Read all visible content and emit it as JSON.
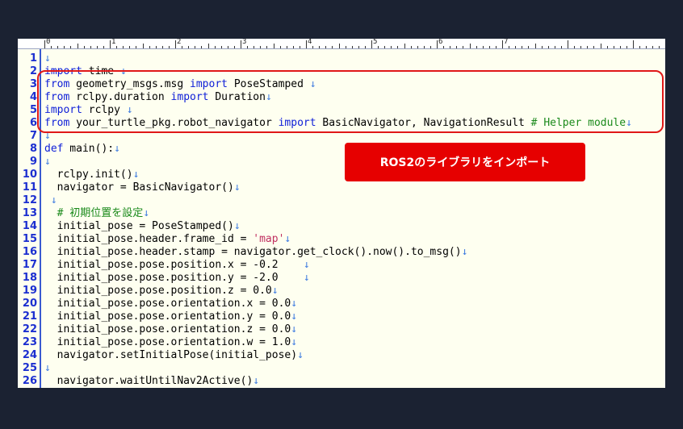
{
  "annotation": {
    "callout_text": "ROS2のライブラリをインポート",
    "callout_color": "#e60000",
    "highlight_border_color": "#e01818"
  },
  "editor": {
    "ruler_numbers": [
      "0",
      "1",
      "2",
      "3",
      "4",
      "5",
      "6",
      "7"
    ],
    "line_numbers": [
      "1",
      "2",
      "3",
      "4",
      "5",
      "6",
      "7",
      "8",
      "9",
      "10",
      "11",
      "12",
      "13",
      "14",
      "15",
      "16",
      "17",
      "18",
      "19",
      "20",
      "21",
      "22",
      "23",
      "24",
      "25",
      "26"
    ],
    "eol_mark": "↓",
    "lines": [
      [],
      [
        [
          "kw",
          "import"
        ],
        [
          "t",
          " time "
        ],
        [
          "eol",
          "↓"
        ]
      ],
      [
        [
          "kw",
          "from"
        ],
        [
          "t",
          " geometry_msgs.msg "
        ],
        [
          "kw",
          "import"
        ],
        [
          "t",
          " PoseStamped "
        ],
        [
          "eol",
          "↓"
        ]
      ],
      [
        [
          "kw",
          "from"
        ],
        [
          "t",
          " rclpy.duration "
        ],
        [
          "kw",
          "import"
        ],
        [
          "t",
          " Duration"
        ],
        [
          "eol",
          "↓"
        ]
      ],
      [
        [
          "kw",
          "import"
        ],
        [
          "t",
          " rclpy "
        ],
        [
          "eol",
          "↓"
        ]
      ],
      [
        [
          "kw",
          "from"
        ],
        [
          "t",
          " your_turtle_pkg.robot_navigator "
        ],
        [
          "kw",
          "import"
        ],
        [
          "t",
          " BasicNavigator, NavigationResult "
        ],
        [
          "cmt",
          "# Helper module"
        ],
        [
          "eol",
          "↓"
        ]
      ],
      [],
      [
        [
          "kw",
          "def"
        ],
        [
          "t",
          " main():"
        ],
        [
          "eol",
          "↓"
        ]
      ],
      [],
      [
        [
          "t",
          "  rclpy.init()"
        ],
        [
          "eol",
          "↓"
        ]
      ],
      [
        [
          "t",
          "  navigator = BasicNavigator()"
        ],
        [
          "eol",
          "↓"
        ]
      ],
      [
        [
          "t",
          " "
        ],
        [
          "eol",
          "↓"
        ]
      ],
      [
        [
          "t",
          "  "
        ],
        [
          "cmt",
          "# 初期位置を設定"
        ],
        [
          "eol",
          "↓"
        ]
      ],
      [
        [
          "t",
          "  initial_pose = PoseStamped()"
        ],
        [
          "eol",
          "↓"
        ]
      ],
      [
        [
          "t",
          "  initial_pose.header.frame_id = "
        ],
        [
          "str",
          "'map'"
        ],
        [
          "eol",
          "↓"
        ]
      ],
      [
        [
          "t",
          "  initial_pose.header.stamp = navigator.get_clock().now().to_msg()"
        ],
        [
          "eol",
          "↓"
        ]
      ],
      [
        [
          "t",
          "  initial_pose.pose.position.x = -0.2    "
        ],
        [
          "eol",
          "↓"
        ]
      ],
      [
        [
          "t",
          "  initial_pose.pose.position.y = -2.0    "
        ],
        [
          "eol",
          "↓"
        ]
      ],
      [
        [
          "t",
          "  initial_pose.pose.position.z = 0.0"
        ],
        [
          "eol",
          "↓"
        ]
      ],
      [
        [
          "t",
          "  initial_pose.pose.orientation.x = 0.0"
        ],
        [
          "eol",
          "↓"
        ]
      ],
      [
        [
          "t",
          "  initial_pose.pose.orientation.y = 0.0"
        ],
        [
          "eol",
          "↓"
        ]
      ],
      [
        [
          "t",
          "  initial_pose.pose.orientation.z = 0.0"
        ],
        [
          "eol",
          "↓"
        ]
      ],
      [
        [
          "t",
          "  initial_pose.pose.orientation.w = 1.0"
        ],
        [
          "eol",
          "↓"
        ]
      ],
      [
        [
          "t",
          "  navigator.setInitialPose(initial_pose)"
        ],
        [
          "eol",
          "↓"
        ]
      ],
      [],
      [
        [
          "t",
          "  navigator.waitUntilNav2Active()"
        ],
        [
          "eol",
          "↓"
        ]
      ]
    ]
  }
}
